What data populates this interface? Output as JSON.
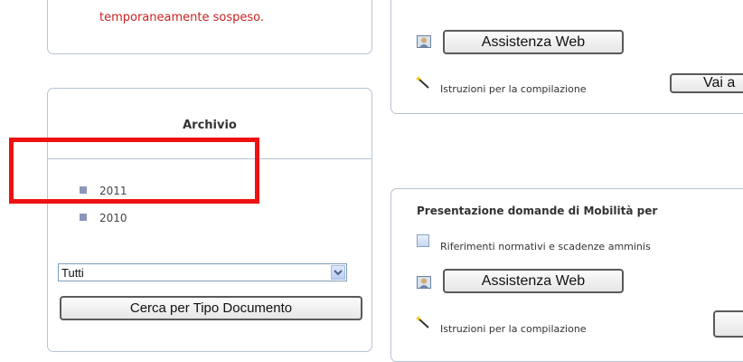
{
  "left": {
    "notice_text": "temporaneamente sospeso.",
    "archive": {
      "title": "Archivio",
      "years": [
        {
          "label": "2011"
        },
        {
          "label": "2010"
        }
      ]
    },
    "filter": {
      "selected": "Tutti",
      "search_button": "Cerca per Tipo Documento"
    }
  },
  "right_top": {
    "assist_button": "Assistenza Web",
    "instructions_label": "Istruzioni per la compilazione",
    "go_button": "Vai a"
  },
  "right_bottom": {
    "title": "Presentazione domande di Mobilità per",
    "references_link": "Riferimenti normativi e scadenze amminis",
    "assist_button": "Assistenza Web",
    "instructions_label": "Istruzioni per la compilazione"
  },
  "colors": {
    "notice_red": "#cc2222",
    "highlight_red": "#ee1111",
    "bullet_blue": "#8a96ba"
  }
}
